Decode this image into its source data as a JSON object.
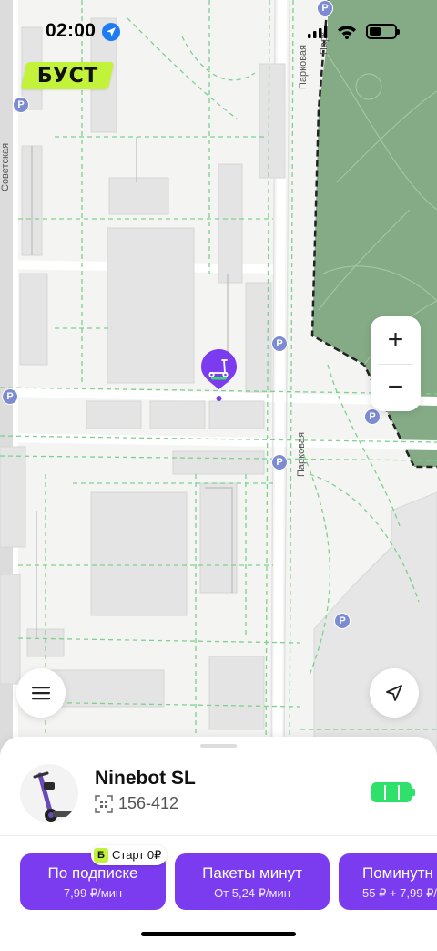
{
  "status_bar": {
    "time": "02:00",
    "icons": [
      "location-arrow-icon",
      "signal-icon",
      "wifi-icon",
      "battery-icon"
    ]
  },
  "logo": {
    "text": "БУСТ",
    "color": "#c3f23a"
  },
  "map": {
    "street_labels": [
      "Советская",
      "Парковая",
      "Парковая",
      "Парк"
    ],
    "parking_symbol": "P",
    "park_color": "#85ab86",
    "parking_color": "#7d8bd3"
  },
  "zoom": {
    "plus": "+",
    "minus": "−"
  },
  "pin": {
    "color": "#7b3cf0"
  },
  "scooter": {
    "model": "Ninebot SL",
    "id": "156-412",
    "battery_level": 1.0,
    "battery_color": "#2fe06a"
  },
  "badge": {
    "letter": "Б",
    "text": "Старт 0₽"
  },
  "tariffs": [
    {
      "title": "По подписке",
      "price": "7,99 ₽/мин"
    },
    {
      "title": "Пакеты минут",
      "price": "От 5,24 ₽/мин"
    },
    {
      "title": "Поминутн",
      "price": "55 ₽ + 7,99 ₽/"
    }
  ],
  "accent_color": "#7b3cf0"
}
